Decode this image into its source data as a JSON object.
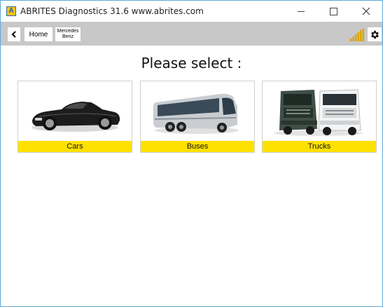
{
  "window": {
    "title": "ABRITES Diagnostics 31.6   www.abrites.com",
    "app_icon_letter": "A"
  },
  "toolbar": {
    "back_icon": "chevron-left-icon",
    "home_label": "Home",
    "brand_label_line1": "Mercedes",
    "brand_label_line2": "Benz",
    "signal_icon": "signal-strength-icon",
    "settings_icon": "gear-icon",
    "signal_color": "#d9a400"
  },
  "main": {
    "heading": "Please select :",
    "categories": [
      {
        "label": "Cars",
        "icon": "car-image"
      },
      {
        "label": "Buses",
        "icon": "bus-image"
      },
      {
        "label": "Trucks",
        "icon": "truck-image"
      }
    ],
    "accent_color": "#ffe100"
  }
}
